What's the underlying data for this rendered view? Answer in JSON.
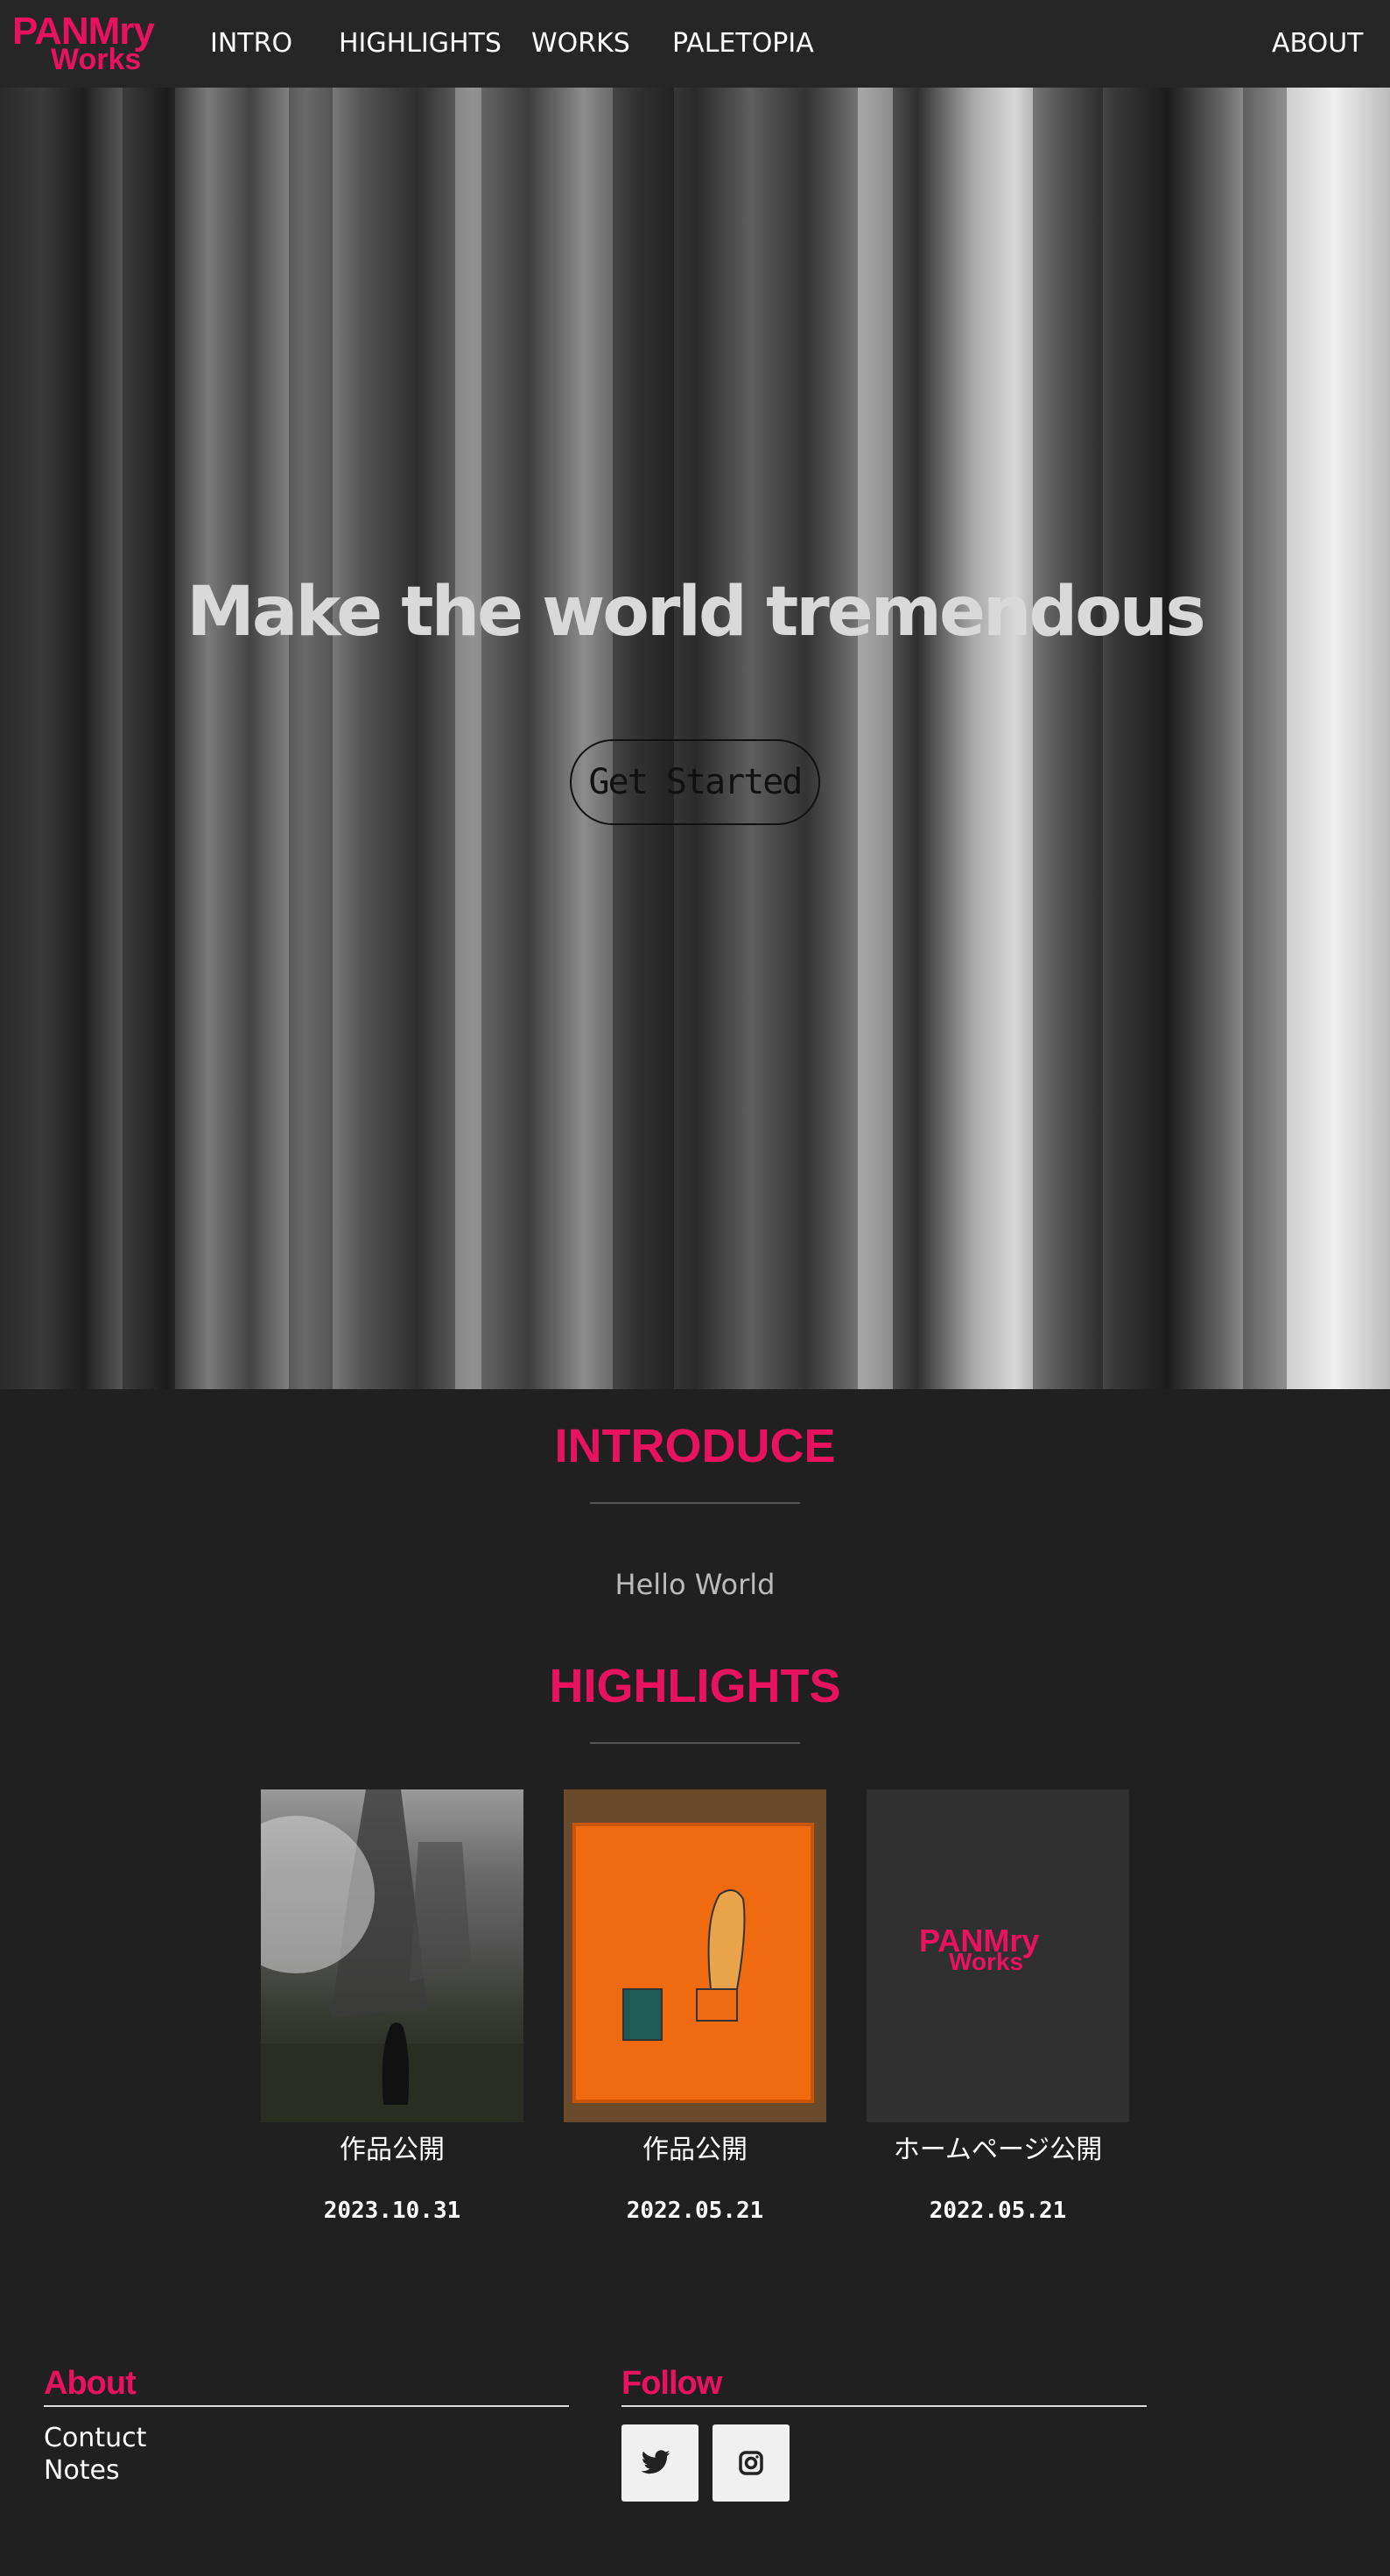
{
  "nav": {
    "logo_top": "PANMry",
    "logo_bottom": "Works",
    "links": [
      "INTRO",
      "HIGHLIGHTS",
      "WORKS",
      "PALETOPIA"
    ],
    "about": "ABOUT"
  },
  "hero": {
    "title": "Make the world tremendous",
    "button": "Get Started"
  },
  "introduce": {
    "title": "INTRODUCE",
    "text": "Hello World"
  },
  "highlights": {
    "title": "HIGHLIGHTS",
    "items": [
      {
        "title": "作品公開",
        "date": "2023.10.31"
      },
      {
        "title": "作品公開",
        "date": "2022.05.21"
      },
      {
        "title": "ホームページ公開",
        "date": "2022.05.21",
        "logo_top": "PANMry",
        "logo_bottom": "Works"
      }
    ]
  },
  "footer": {
    "about_title": "About",
    "links": [
      "Contuct",
      "Notes"
    ],
    "follow_title": "Follow",
    "social": [
      "twitter-icon",
      "instagram-icon"
    ]
  },
  "colors": {
    "accent": "#e8125f",
    "background": "#202020",
    "nav": "#262626"
  }
}
